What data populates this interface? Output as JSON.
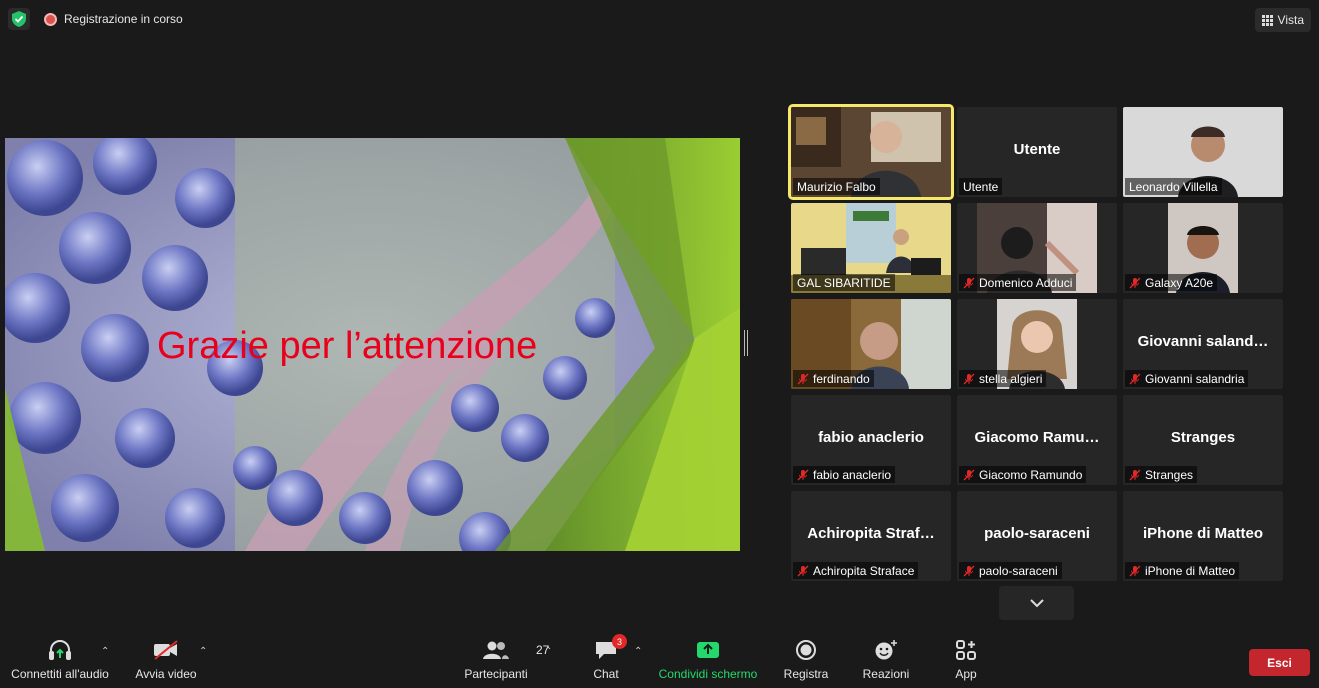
{
  "topbar": {
    "recording_label": "Registrazione in corso",
    "view_label": "Vista"
  },
  "slide": {
    "text": "Grazie per l’attenzione"
  },
  "gallery": [
    {
      "big": "",
      "label": "Maurizio Falbo",
      "muted": false,
      "active": true
    },
    {
      "big": "Utente",
      "label": "Utente",
      "muted": false
    },
    {
      "big": "",
      "label": "Leonardo Villella",
      "muted": false
    },
    {
      "big": "",
      "label": "GAL SIBARITIDE",
      "muted": false
    },
    {
      "big": "",
      "label": "Domenico Adduci",
      "muted": true
    },
    {
      "big": "",
      "label": "Galaxy A20e",
      "muted": true
    },
    {
      "big": "",
      "label": "ferdinando",
      "muted": true
    },
    {
      "big": "",
      "label": "stella algieri",
      "muted": true
    },
    {
      "big": "Giovanni  saland…",
      "label": "Giovanni salandria",
      "muted": true
    },
    {
      "big": "fabio anaclerio",
      "label": "fabio anaclerio",
      "muted": true
    },
    {
      "big": "Giacomo  Ramu…",
      "label": "Giacomo Ramundo",
      "muted": true
    },
    {
      "big": "Stranges",
      "label": "Stranges",
      "muted": true
    },
    {
      "big": "Achiropita  Straf…",
      "label": "Achiropita Straface",
      "muted": true
    },
    {
      "big": "paolo-saraceni",
      "label": "paolo-saraceni",
      "muted": true
    },
    {
      "big": "iPhone di Matteo",
      "label": "iPhone di Matteo",
      "muted": true
    }
  ],
  "toolbar": {
    "audio": "Connettiti all'audio",
    "video": "Avvia video",
    "participants": "Partecipanti",
    "participants_count": "27",
    "chat": "Chat",
    "chat_badge": "3",
    "share": "Condividi schermo",
    "record": "Registra",
    "reactions": "Reazioni",
    "apps": "App",
    "leave": "Esci"
  },
  "colors": {
    "accent_share": "#23d96b",
    "leave": "#c4262e",
    "active_speaker": "#f5e86a",
    "slide_text": "#e8001c"
  }
}
